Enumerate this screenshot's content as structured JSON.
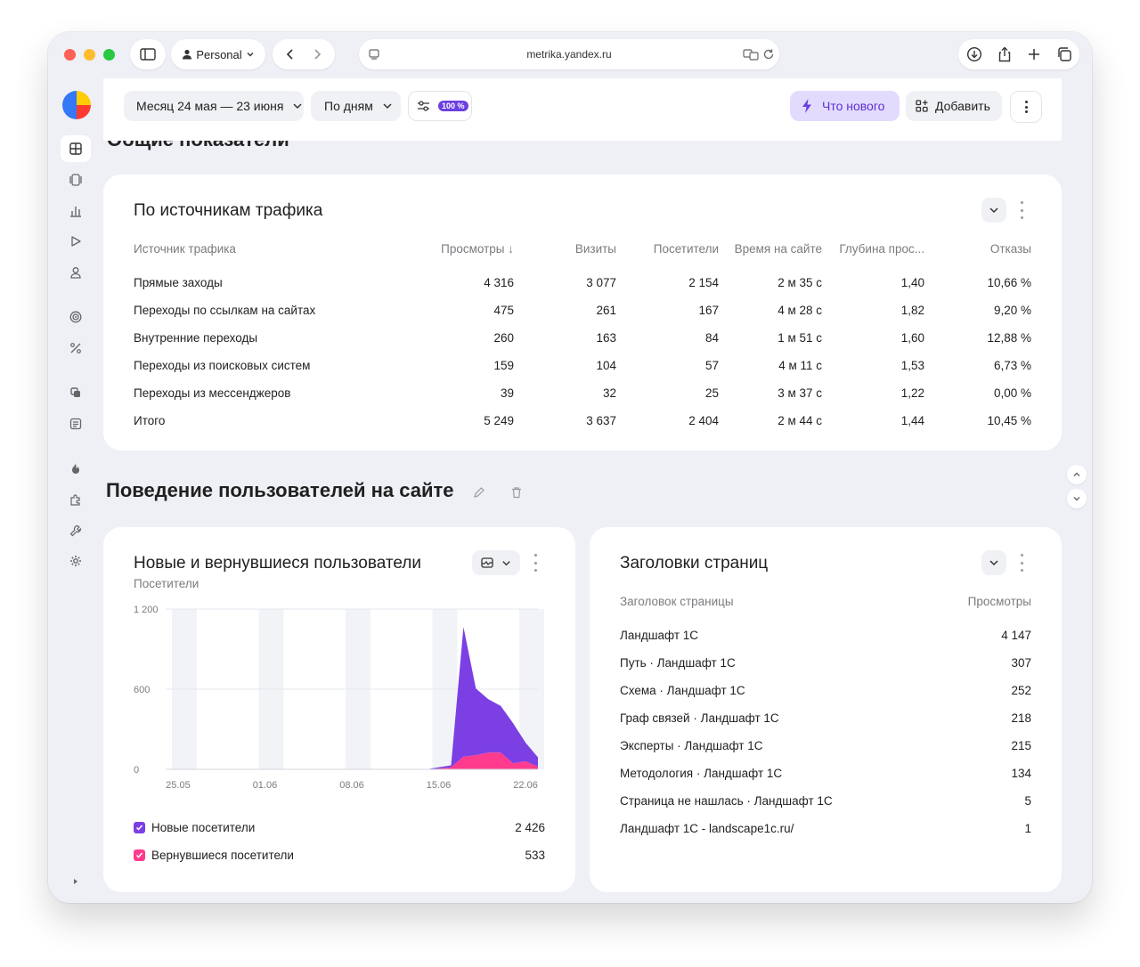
{
  "browser": {
    "profile": "Personal",
    "url": "metrika.yandex.ru"
  },
  "header": {
    "date_range": "Месяц 24 мая — 23 июня",
    "grouping": "По дням",
    "sampling_badge": "100 %",
    "whats_new": "Что нового",
    "add": "Добавить"
  },
  "partial_section_title": "Общие показатели",
  "traffic": {
    "title": "По источникам трафика",
    "columns": [
      "Источник трафика",
      "Просмотры ↓",
      "Визиты",
      "Посетители",
      "Время на сайте",
      "Глубина прос...",
      "Отказы"
    ],
    "rows": [
      [
        "Прямые заходы",
        "4 316",
        "3 077",
        "2 154",
        "2 м 35 с",
        "1,40",
        "10,66 %"
      ],
      [
        "Переходы по ссылкам на сайтах",
        "475",
        "261",
        "167",
        "4 м 28 с",
        "1,82",
        "9,20 %"
      ],
      [
        "Внутренние переходы",
        "260",
        "163",
        "84",
        "1 м 51 с",
        "1,60",
        "12,88 %"
      ],
      [
        "Переходы из поисковых систем",
        "159",
        "104",
        "57",
        "4 м 11 с",
        "1,53",
        "6,73 %"
      ],
      [
        "Переходы из мессенджеров",
        "39",
        "32",
        "25",
        "3 м 37 с",
        "1,22",
        "0,00 %"
      ],
      [
        "Итого",
        "5 249",
        "3 637",
        "2 404",
        "2 м 44 с",
        "1,44",
        "10,45 %"
      ]
    ]
  },
  "behavior_title": "Поведение пользователей на сайте",
  "users_chart": {
    "title": "Новые и вернувшиеся пользователи",
    "subtitle": "Посетители",
    "legend": [
      {
        "label": "Новые посетители",
        "value": "2 426",
        "color": "#7b3fe4"
      },
      {
        "label": "Вернувшиеся посетители",
        "value": "533",
        "color": "#ff3b8d"
      }
    ]
  },
  "chart_data": {
    "type": "area",
    "ylim": [
      0,
      1200
    ],
    "yticks": [
      "1 200",
      "600",
      "0"
    ],
    "x_tick_labels": [
      "25.05",
      "01.06",
      "08.06",
      "15.06",
      "22.06"
    ],
    "x": [
      "24.05",
      "25.05",
      "26.05",
      "27.05",
      "28.05",
      "29.05",
      "30.05",
      "31.05",
      "01.06",
      "02.06",
      "03.06",
      "04.06",
      "05.06",
      "06.06",
      "07.06",
      "08.06",
      "09.06",
      "10.06",
      "11.06",
      "12.06",
      "13.06",
      "14.06",
      "15.06",
      "16.06",
      "17.06",
      "18.06",
      "19.06",
      "20.06",
      "21.06",
      "22.06",
      "23.06"
    ],
    "series": [
      {
        "name": "Вернувшиеся посетители",
        "color": "#ff3b8d",
        "values": [
          0,
          0,
          0,
          0,
          0,
          0,
          0,
          0,
          0,
          0,
          0,
          0,
          0,
          0,
          0,
          0,
          0,
          0,
          0,
          0,
          0,
          0,
          5,
          15,
          95,
          105,
          125,
          125,
          45,
          60,
          20
        ]
      },
      {
        "name": "Новые посетители",
        "color": "#7b3fe4",
        "values": [
          0,
          0,
          0,
          0,
          0,
          0,
          0,
          0,
          0,
          0,
          0,
          0,
          0,
          0,
          0,
          0,
          0,
          0,
          0,
          0,
          0,
          0,
          10,
          15,
          970,
          500,
          400,
          350,
          300,
          140,
          70
        ]
      }
    ]
  },
  "pages": {
    "title": "Заголовки страниц",
    "columns": [
      "Заголовок страницы",
      "Просмотры"
    ],
    "rows": [
      [
        "Ландшафт 1С",
        "4 147"
      ],
      [
        "Путь · Ландшафт 1С",
        "307"
      ],
      [
        "Схема · Ландшафт 1С",
        "252"
      ],
      [
        "Граф связей · Ландшафт 1С",
        "218"
      ],
      [
        "Эксперты · Ландшафт 1С",
        "215"
      ],
      [
        "Методология · Ландшафт 1С",
        "134"
      ],
      [
        "Страница не нашлась · Ландшафт 1С",
        "5"
      ],
      [
        "Ландшафт 1С - landscape1c.ru/",
        "1"
      ]
    ]
  }
}
